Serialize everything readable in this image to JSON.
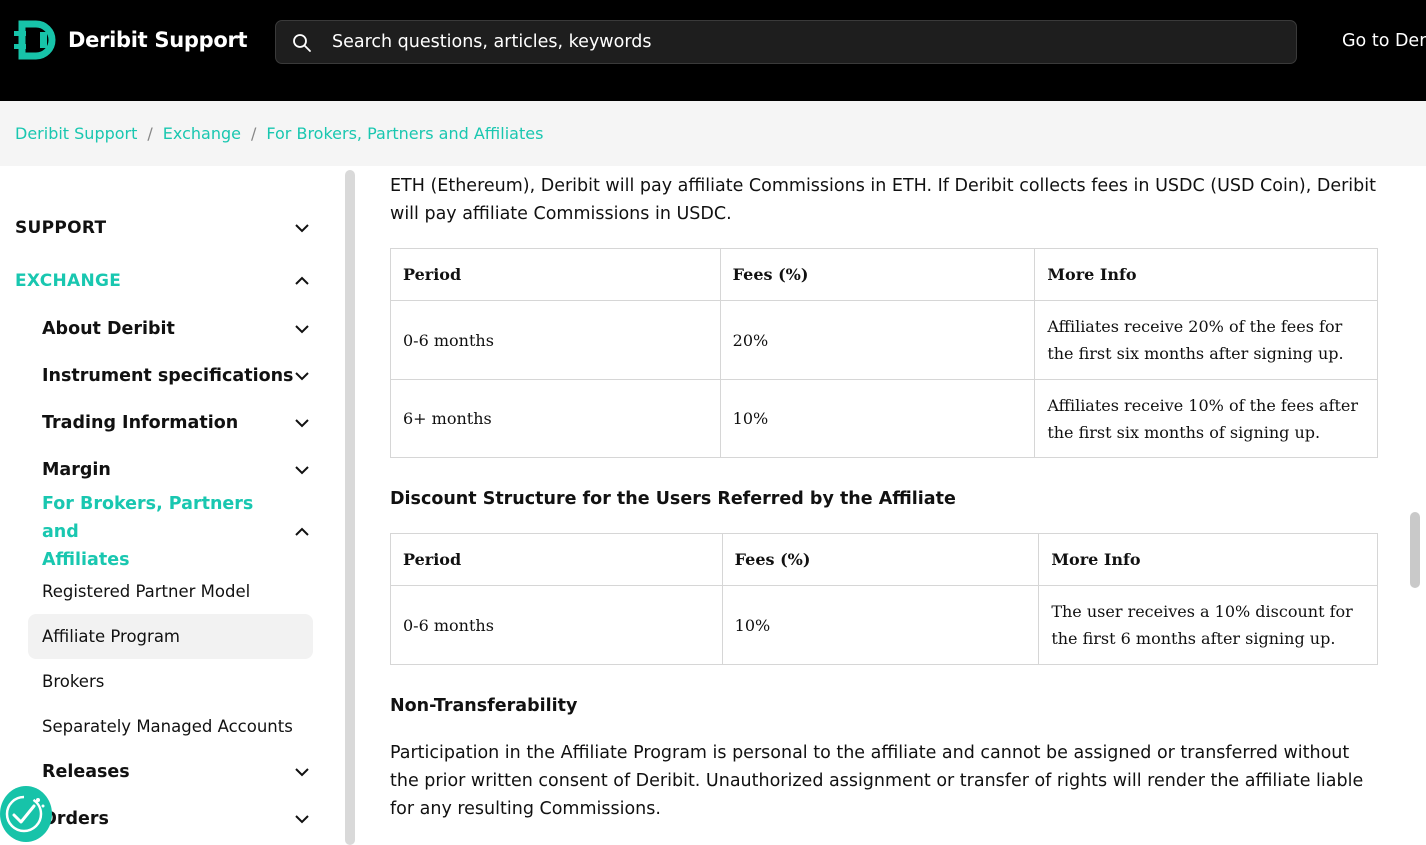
{
  "header": {
    "brand": "Deribit Support",
    "search_placeholder": "Search questions, articles, keywords",
    "goto_label": "Go to Deri"
  },
  "breadcrumb": [
    "Deribit Support",
    "Exchange",
    "For Brokers, Partners and Affiliates"
  ],
  "sidebar": {
    "support": "SUPPORT",
    "exchange": "EXCHANGE",
    "about": "About Deribit",
    "instrument": "Instrument specifications",
    "trading": "Trading Information",
    "margin": "Margin",
    "brokers_section_line1": "For Brokers, Partners and",
    "brokers_section_line2": "Affiliates",
    "registered": "Registered Partner Model",
    "affiliate": "Affiliate Program",
    "brokers": "Brokers",
    "sma": "Separately Managed Accounts",
    "releases": "Releases",
    "orders": "Orders"
  },
  "content": {
    "intro": "ETH (Ethereum), Deribit will pay affiliate Commissions in ETH. If Deribit collects fees in USDC (USD Coin), Deribit will pay affiliate Commissions in USDC.",
    "table1": {
      "headers": [
        "Period",
        "Fees (%)",
        "More Info"
      ],
      "rows": [
        [
          "0-6 months",
          "20%",
          "Affiliates receive 20% of the fees for the first six months after signing up."
        ],
        [
          "6+ months",
          "10%",
          "Affiliates receive 10% of the fees after the first six months of signing up."
        ]
      ]
    },
    "discount_heading": "Discount Structure for the Users Referred by the Affiliate",
    "table2": {
      "headers": [
        "Period",
        "Fees (%)",
        "More Info"
      ],
      "rows": [
        [
          "0-6 months",
          "10%",
          "The user receives a 10% discount for the first 6 months after signing up."
        ]
      ]
    },
    "nontransfer_heading": "Non-Transferability",
    "nontransfer_text": "Participation in the Affiliate Program is personal to the affiliate and cannot be assigned or transferred without the prior written consent of Deribit. Unauthorized assignment or transfer of rights will render the affiliate liable for any resulting Commissions."
  },
  "colors": {
    "accent": "#19c7b0",
    "header_bg": "#000000"
  }
}
